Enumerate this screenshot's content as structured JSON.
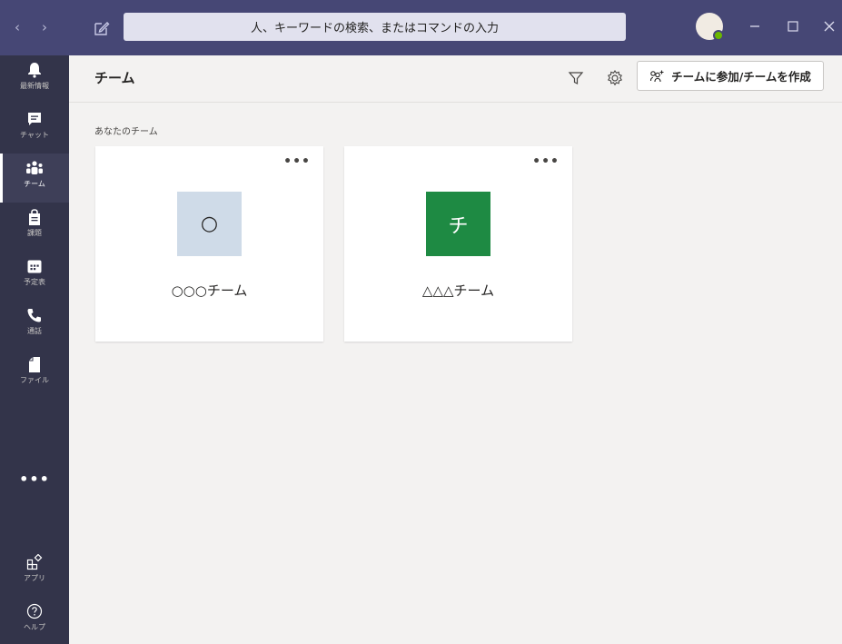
{
  "window": {
    "back_icon": "chevron-left-icon",
    "forward_icon": "chevron-right-icon",
    "compose_icon": "compose-icon",
    "search_placeholder": "人、キーワードの検索、またはコマンドの入力",
    "controls": [
      "minimize-icon",
      "maximize-icon",
      "close-icon"
    ]
  },
  "rail": {
    "items": [
      {
        "label": "最新情報",
        "icon": "bell-icon"
      },
      {
        "label": "チャット",
        "icon": "chat-icon"
      },
      {
        "label": "チーム",
        "icon": "teams-icon",
        "active": true
      },
      {
        "label": "課題",
        "icon": "assignments-icon"
      },
      {
        "label": "予定表",
        "icon": "calendar-icon"
      },
      {
        "label": "通話",
        "icon": "phone-icon"
      },
      {
        "label": "ファイル",
        "icon": "file-icon"
      }
    ],
    "more": "•••",
    "bottom": [
      {
        "label": "アプリ",
        "icon": "apps-icon"
      },
      {
        "label": "ヘルプ",
        "icon": "help-icon"
      }
    ]
  },
  "header": {
    "title": "チーム",
    "join_button_label": "チームに参加/チームを作成"
  },
  "section": {
    "label": "あなたのチーム"
  },
  "teams": [
    {
      "name": "○○○チーム",
      "avatar_text": "○",
      "avatar_color": "#cfdbe8",
      "avatar_text_color": "#252423",
      "more": "•••"
    },
    {
      "name": "△△△チーム",
      "avatar_text": "チ",
      "avatar_color": "#1e8a43",
      "avatar_text_color": "#ffffff",
      "more": "•••"
    }
  ],
  "colors": {
    "titlebar": "#464775",
    "rail": "#33344a",
    "background": "#f3f2f1"
  }
}
